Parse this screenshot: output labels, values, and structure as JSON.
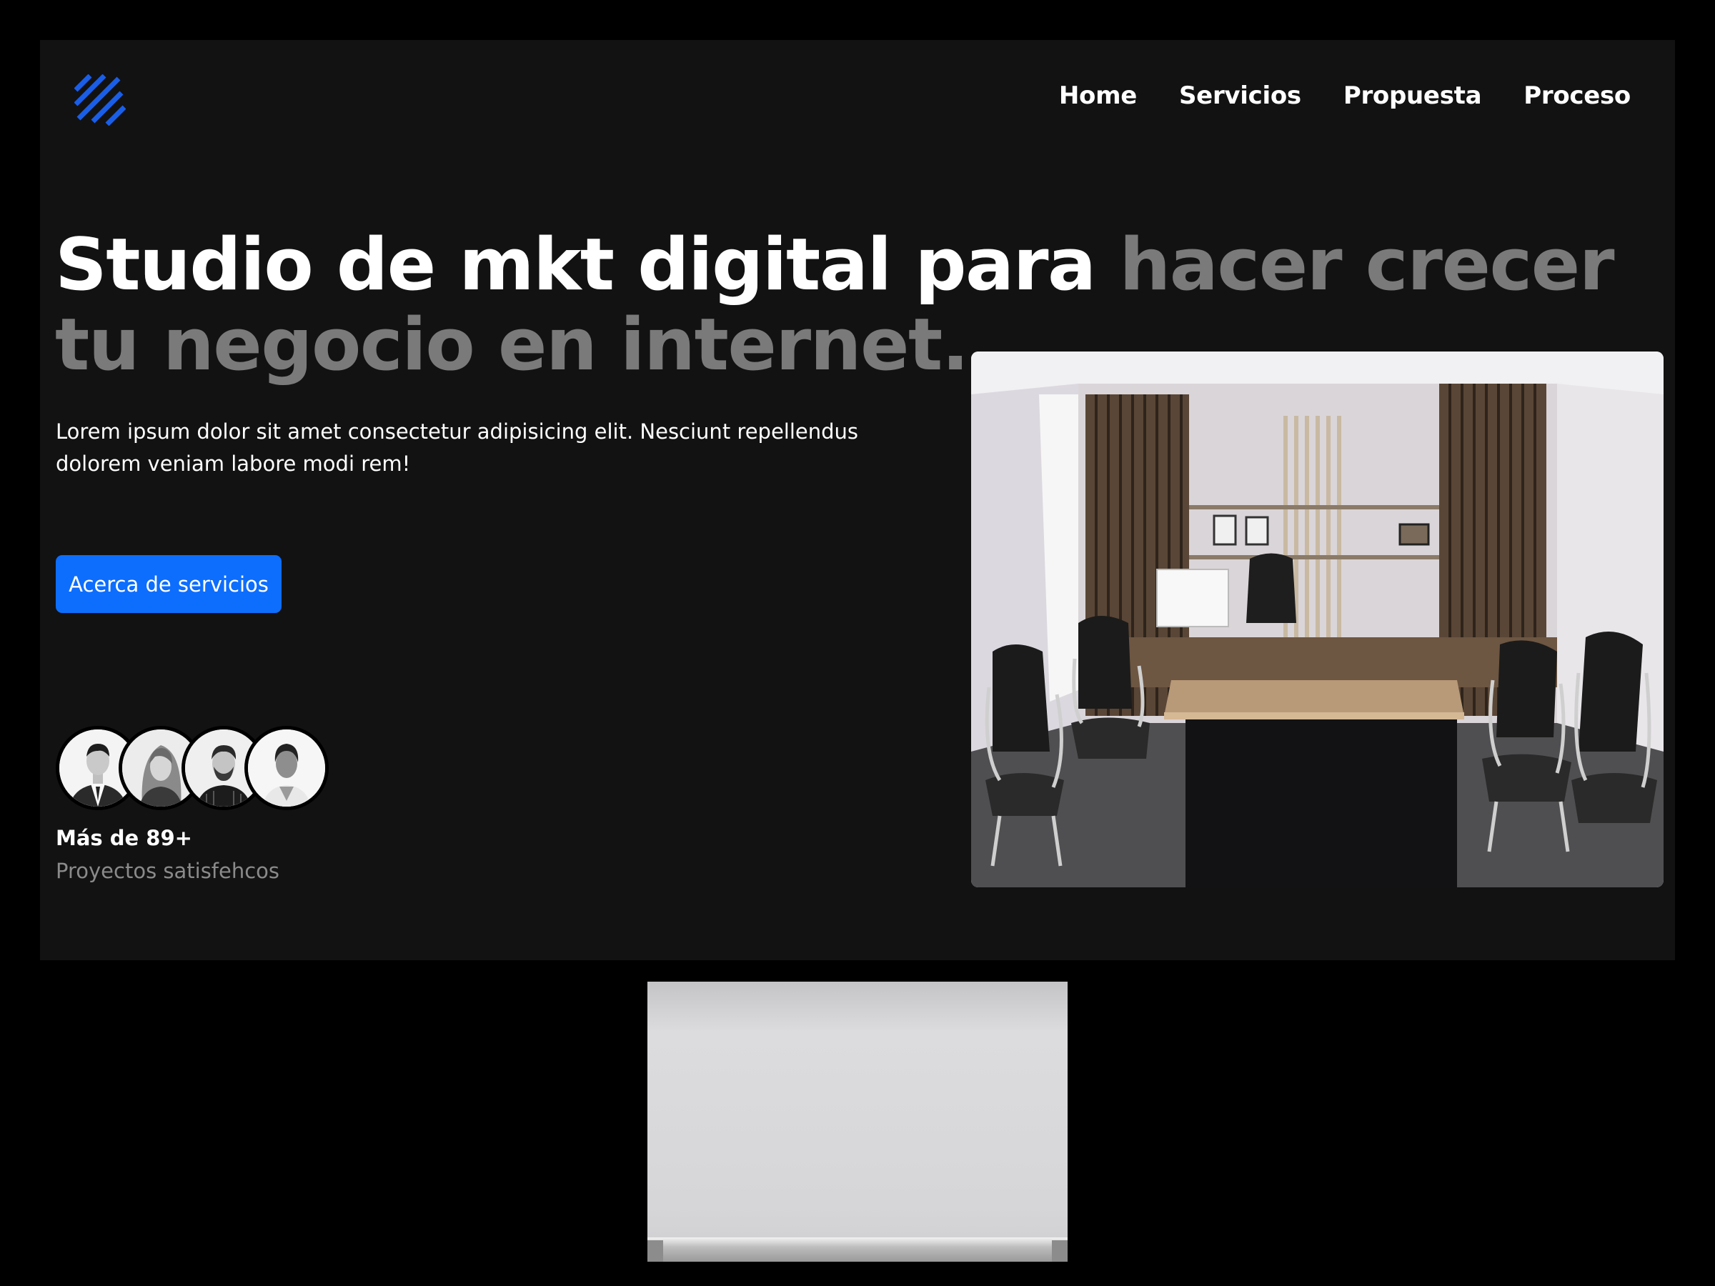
{
  "nav": {
    "items": [
      {
        "label": "Home"
      },
      {
        "label": "Servicios"
      },
      {
        "label": "Propuesta"
      },
      {
        "label": "Proceso"
      }
    ]
  },
  "hero": {
    "headline_white": "Studio de mkt digital para",
    "headline_gray": "hacer crecer tu negocio en internet.",
    "description": "Lorem ipsum dolor sit amet consectetur adipisicing elit. Nesciunt repellendus dolorem veniam labore modi rem!",
    "cta_label": "Acerca de servicios"
  },
  "stats": {
    "number": "Más de 89+",
    "label": "Proyectos satisfehcos"
  },
  "colors": {
    "accent": "#0d6efd",
    "background": "#121212",
    "muted_text": "#7a7a7a"
  },
  "icons": {
    "logo": "diagonal-stripes-logo-icon"
  }
}
